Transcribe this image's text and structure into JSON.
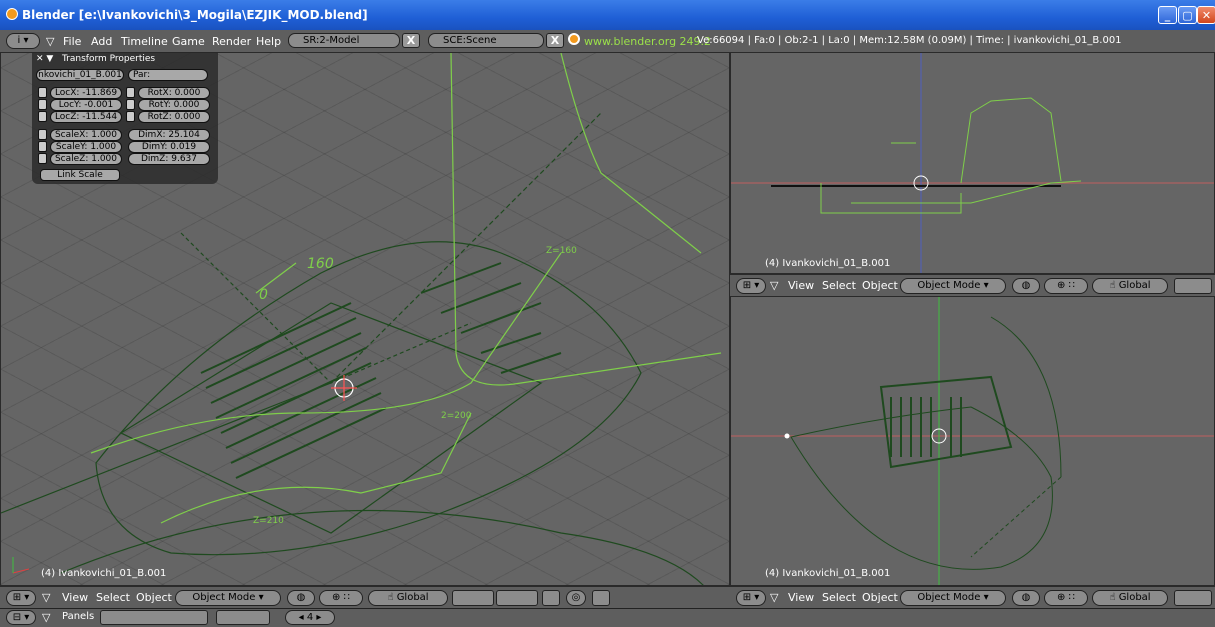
{
  "window": {
    "title": "Blender [e:\\Ivankovichi\\3_Mogila\\EZJIK_MOD.blend]",
    "buttons": [
      "minimize",
      "maximize",
      "close"
    ]
  },
  "info_header": {
    "menu": [
      "File",
      "Add",
      "Timeline",
      "Game",
      "Render",
      "Help"
    ],
    "screen_field": "SR:2-Model",
    "scene_field": "SCE:Scene",
    "url": "www.blender.org 249.2",
    "stats": "Ve:66094 | Fa:0 | Ob:2-1 | La:0  | Mem:12.58M (0.09M) | Time: | ivankovichi_01_B.001"
  },
  "transform_panel": {
    "title": "Transform Properties",
    "ob_name": "nkovichi_01_B.001",
    "par": "Par:",
    "loc": [
      "LocX: -11.869",
      "LocY: -0.001",
      "LocZ: -11.544"
    ],
    "rot": [
      "RotX: 0.000",
      "RotY: 0.000",
      "RotZ: 0.000"
    ],
    "scale": [
      "ScaleX: 1.000",
      "ScaleY: 1.000",
      "ScaleZ: 1.000"
    ],
    "dim": [
      "DimX: 25.104",
      "DimY: 0.019",
      "DimZ: 9.637"
    ],
    "link_scale": "Link Scale"
  },
  "viewports": {
    "main_label": "(4) Ivankovichi_01_B.001",
    "top_right_label": "(4) Ivankovichi_01_B.001",
    "bottom_right_label": "(4) Ivankovichi_01_B.001",
    "drawing_labels": [
      "160",
      "0",
      "Z=160",
      "Z=210",
      "2=200"
    ]
  },
  "vp_header": {
    "view": "View",
    "select": "Select",
    "object": "Object",
    "mode": "Object Mode",
    "orientation": "Global"
  },
  "bottom": {
    "panels": "Panels",
    "frame": "4"
  },
  "colors": {
    "accent_green": "#7fcf4a",
    "dark_green": "#1f4a1f",
    "viewport": "#656565"
  }
}
